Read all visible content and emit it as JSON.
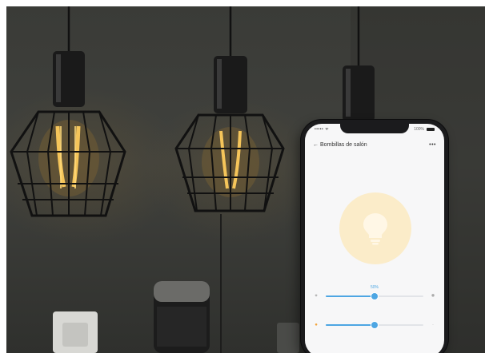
{
  "scene": {
    "description_icons": [
      "pendant-lamp",
      "smart-speaker",
      "wall-outlet"
    ]
  },
  "phone": {
    "status_bar": {
      "carrier": "•••••  ᯤ",
      "battery": "100%"
    },
    "nav": {
      "back_icon": "‹",
      "title": "← Bombillas de salón",
      "more_icon": "•••"
    },
    "brightness_percent_label": "50%",
    "brightness_level": 0.5,
    "temperature_level": 0.5,
    "colors": {
      "accent": "#4da6e3",
      "bulb_glow": "#fbecc9",
      "sun": "#f2a33a"
    }
  }
}
